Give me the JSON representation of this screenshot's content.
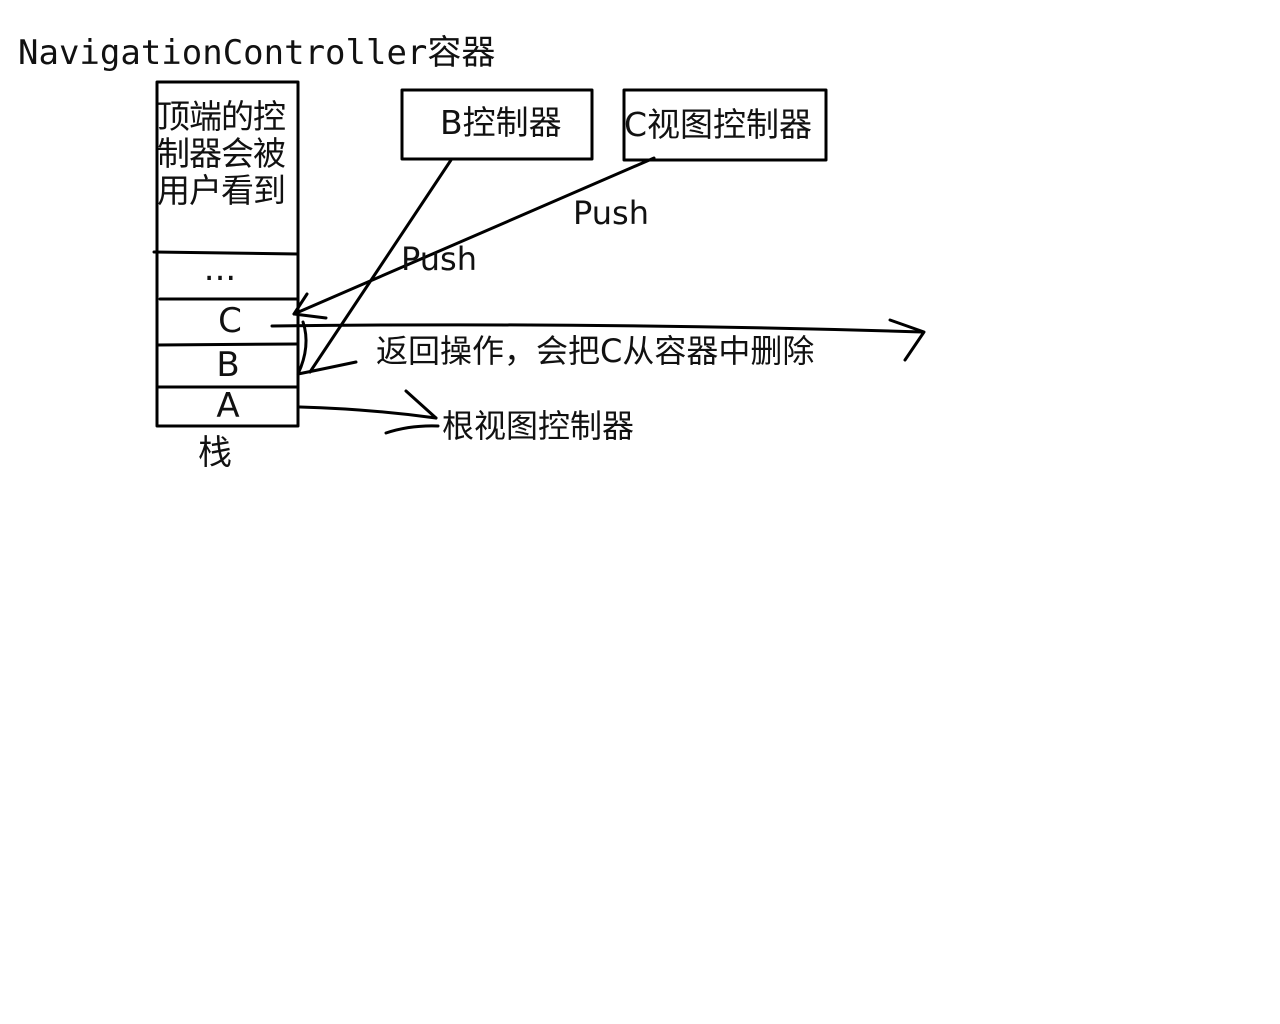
{
  "diagram": {
    "title": "NavigationController容器",
    "stack": {
      "top_note": "顶端的控制器会被用户看到",
      "cells": [
        "...",
        "C",
        "B",
        "A"
      ],
      "caption": "栈"
    },
    "boxes": {
      "b_controller": "B控制器",
      "c_view_controller": "C视图控制器"
    },
    "arrows": {
      "push_from_b": "Push",
      "push_from_c": "Push"
    },
    "notes": {
      "pop_note": "返回操作，会把C从容器中删除",
      "root_note": "根视图控制器"
    }
  }
}
